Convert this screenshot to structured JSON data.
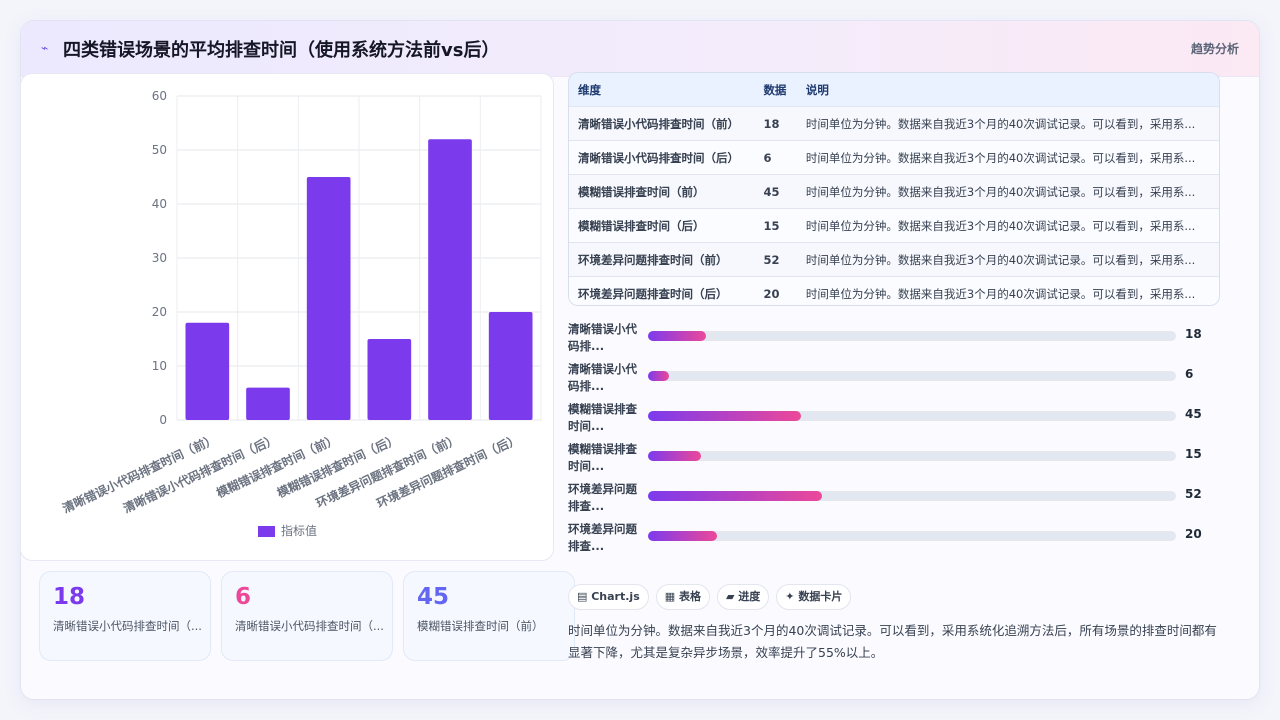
{
  "header": {
    "icon": "trend-line-icon",
    "title": "四类错误场景的平均排查时间（使用系统方法前vs后）",
    "tag": "趋势分析"
  },
  "colors": {
    "accent": "#7c3aed",
    "accent2": "#ec4899",
    "kpi1": "#7c3aed",
    "kpi2": "#ec4899",
    "kpi3": "#6366f1"
  },
  "chart_data": {
    "type": "bar",
    "categories": [
      "清晰错误小代码排查时间（前）",
      "清晰错误小代码排查时间（后）",
      "模糊错误排查时间（前）",
      "模糊错误排查时间（后）",
      "环境差异问题排查时间（前）",
      "环境差异问题排查时间（后）"
    ],
    "series": [
      {
        "name": "指标值",
        "values": [
          18,
          6,
          45,
          15,
          52,
          20
        ]
      }
    ],
    "ylim": [
      0,
      60
    ],
    "yticks": [
      0,
      10,
      20,
      30,
      40,
      50,
      60
    ],
    "grid": true,
    "legend_position": "bottom"
  },
  "kpis": [
    {
      "value": "18",
      "label": "清晰错误小代码排查时间（..."
    },
    {
      "value": "6",
      "label": "清晰错误小代码排查时间（..."
    },
    {
      "value": "45",
      "label": "模糊错误排查时间（前）"
    }
  ],
  "table": {
    "headers": [
      "维度",
      "数据",
      "说明"
    ],
    "rows": [
      [
        "清晰错误小代码排查时间（前）",
        "18",
        "时间单位为分钟。数据来自我近3个月的40次调试记录。可以看到，采用系..."
      ],
      [
        "清晰错误小代码排查时间（后）",
        "6",
        "时间单位为分钟。数据来自我近3个月的40次调试记录。可以看到，采用系..."
      ],
      [
        "模糊错误排查时间（前）",
        "45",
        "时间单位为分钟。数据来自我近3个月的40次调试记录。可以看到，采用系..."
      ],
      [
        "模糊错误排查时间（后）",
        "15",
        "时间单位为分钟。数据来自我近3个月的40次调试记录。可以看到，采用系..."
      ],
      [
        "环境差异问题排查时间（前）",
        "52",
        "时间单位为分钟。数据来自我近3个月的40次调试记录。可以看到，采用系..."
      ],
      [
        "环境差异问题排查时间（后）",
        "20",
        "时间单位为分钟。数据来自我近3个月的40次调试记录。可以看到，采用系..."
      ]
    ]
  },
  "progress": {
    "max": 52,
    "items": [
      {
        "label": "清晰错误小代码排...",
        "value": 18
      },
      {
        "label": "清晰错误小代码排...",
        "value": 6
      },
      {
        "label": "模糊错误排查时间...",
        "value": 45
      },
      {
        "label": "模糊错误排查时间...",
        "value": 15
      },
      {
        "label": "环境差异问题排查...",
        "value": 52
      },
      {
        "label": "环境差异问题排查...",
        "value": 20
      }
    ]
  },
  "chips": [
    {
      "icon": "chart-icon",
      "glyph": "▤",
      "label": "Chart.js"
    },
    {
      "icon": "table-icon",
      "glyph": "▦",
      "label": "表格"
    },
    {
      "icon": "progress-icon",
      "glyph": "▰",
      "label": "进度"
    },
    {
      "icon": "sparkle-icon",
      "glyph": "✦",
      "label": "数据卡片"
    }
  ],
  "note": "时间单位为分钟。数据来自我近3个月的40次调试记录。可以看到，采用系统化追溯方法后，所有场景的排查时间都有显著下降，尤其是复杂异步场景，效率提升了55%以上。"
}
